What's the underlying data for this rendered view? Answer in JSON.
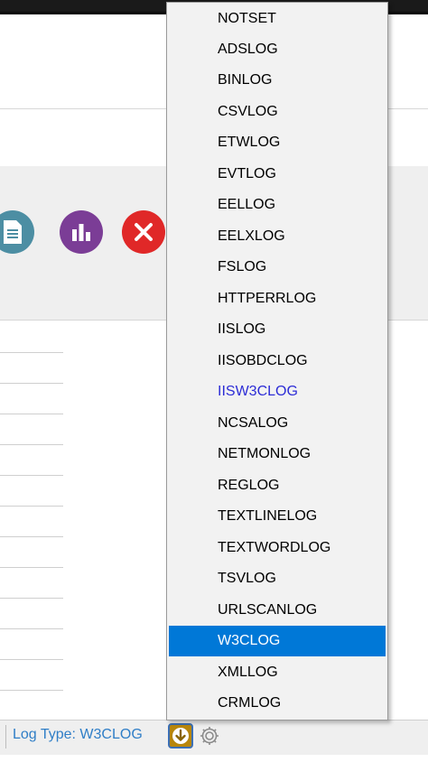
{
  "toolbar": {
    "buttons": [
      {
        "name": "document-icon",
        "color": "#4c8ea3"
      },
      {
        "name": "chart-icon",
        "color": "#7b3d96"
      },
      {
        "name": "close-icon",
        "color": "#e02828"
      }
    ]
  },
  "status": {
    "log_type_label": "Log Type: W3CLOG"
  },
  "menu": {
    "items": [
      {
        "label": "NOTSET",
        "state": "normal"
      },
      {
        "label": "ADSLOG",
        "state": "normal"
      },
      {
        "label": "BINLOG",
        "state": "normal"
      },
      {
        "label": "CSVLOG",
        "state": "normal"
      },
      {
        "label": "ETWLOG",
        "state": "normal"
      },
      {
        "label": "EVTLOG",
        "state": "normal"
      },
      {
        "label": "EELLOG",
        "state": "normal"
      },
      {
        "label": "EELXLOG",
        "state": "normal"
      },
      {
        "label": "FSLOG",
        "state": "normal"
      },
      {
        "label": "HTTPERRLOG",
        "state": "normal"
      },
      {
        "label": "IISLOG",
        "state": "normal"
      },
      {
        "label": "IISOBDCLOG",
        "state": "normal"
      },
      {
        "label": "IISW3CLOG",
        "state": "link"
      },
      {
        "label": "NCSALOG",
        "state": "normal"
      },
      {
        "label": "NETMONLOG",
        "state": "normal"
      },
      {
        "label": "REGLOG",
        "state": "normal"
      },
      {
        "label": "TEXTLINELOG",
        "state": "normal"
      },
      {
        "label": "TEXTWORDLOG",
        "state": "normal"
      },
      {
        "label": "TSVLOG",
        "state": "normal"
      },
      {
        "label": "URLSCANLOG",
        "state": "normal"
      },
      {
        "label": "W3CLOG",
        "state": "selected"
      },
      {
        "label": "XMLLOG",
        "state": "normal"
      },
      {
        "label": "CRMLOG",
        "state": "normal"
      }
    ]
  }
}
